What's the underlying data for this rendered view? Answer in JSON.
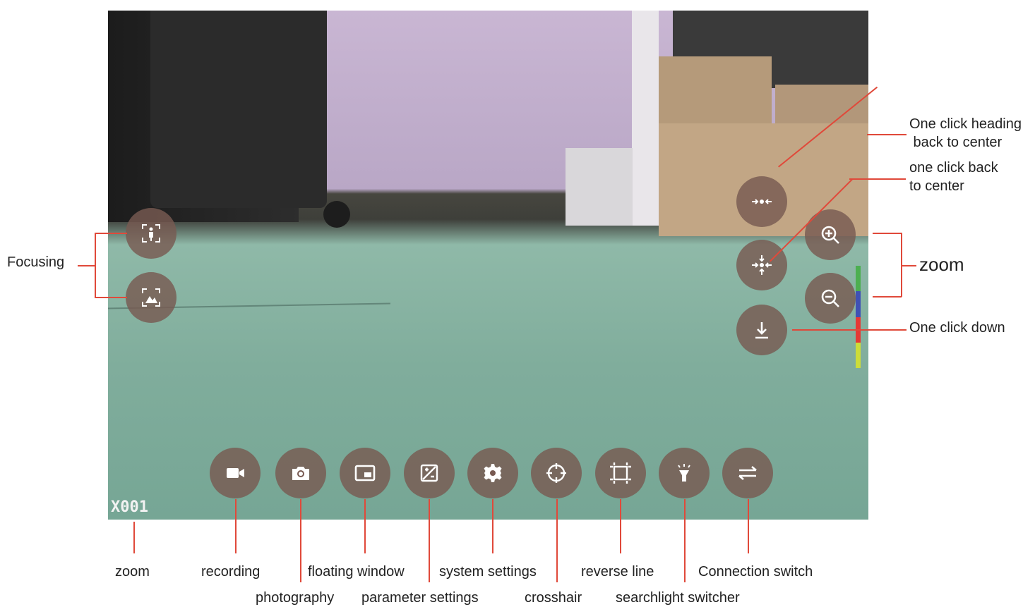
{
  "feed": {
    "camera_id": "X001"
  },
  "buttons": {
    "focus_portrait": "focus-portrait-icon",
    "focus_landscape": "focus-landscape-icon",
    "heading_center": "heading-center-icon",
    "back_center": "back-center-icon",
    "zoom_in": "zoom-in-icon",
    "zoom_out": "zoom-out-icon",
    "one_click_down": "download-arrow-icon",
    "recording": "video-camera-icon",
    "photography": "camera-icon",
    "floating_window": "picture-in-picture-icon",
    "parameter_settings": "exposure-icon",
    "system_settings": "gear-icon",
    "crosshair": "crosshair-icon",
    "reverse_line": "frame-icon",
    "searchlight": "flashlight-icon",
    "connection_switch": "swap-arrows-icon"
  },
  "zoom_bar_colors": [
    "#4caf50",
    "#3f51b5",
    "#e53935",
    "#cddc39"
  ],
  "accent_color": "#e0493a",
  "labels": {
    "focusing": "Focusing",
    "heading_center_1": "One click heading",
    "heading_center_2": " back to center",
    "back_center_1": "one click back",
    "back_center_2": "to center",
    "zoom_right": "zoom",
    "one_click_down": "One click down",
    "zoom_bottom": "zoom",
    "recording": "recording",
    "photography": "photography",
    "floating_window": "floating window",
    "parameter_settings": "parameter settings",
    "system_settings": "system settings",
    "crosshair": "crosshair",
    "reverse_line": "reverse line",
    "searchlight_switcher": "searchlight switcher",
    "connection_switch": "Connection switch"
  }
}
